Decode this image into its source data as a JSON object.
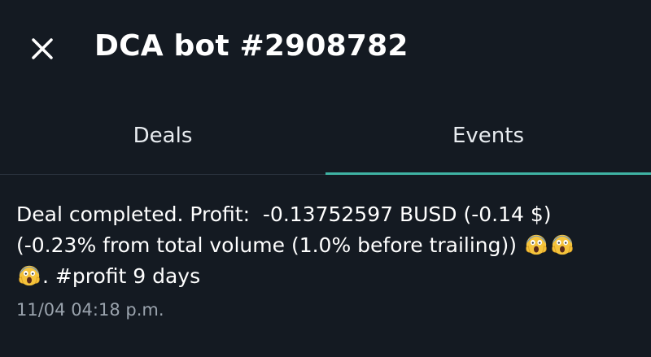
{
  "header": {
    "title": "DCA bot #2908782",
    "close_icon": "close-icon"
  },
  "tabs": [
    {
      "label": "Deals",
      "active": false
    },
    {
      "label": "Events",
      "active": true
    }
  ],
  "event": {
    "line1": "Deal completed. Profit:  -0.13752597 BUSD (-0.14 $)",
    "line2": "(-0.23% from total volume (1.0% before trailing)) ",
    "line3_suffix": ". #profit 9 days",
    "emoji_icon": "screaming-face-emoji",
    "timestamp": "11/04 04:18 p.m."
  },
  "colors": {
    "background": "#141a22",
    "accent": "#3fb3a4",
    "muted_text": "#9aa3ad"
  }
}
